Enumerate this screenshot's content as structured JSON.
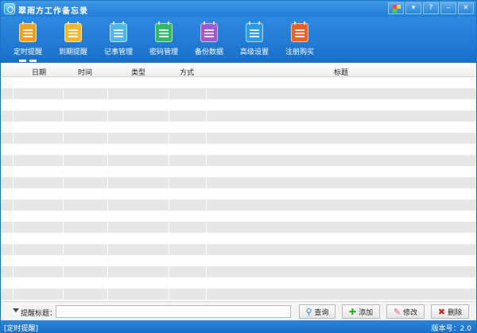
{
  "window": {
    "title": "翠雨方工作备忘录",
    "buttons": [
      "▾",
      "?",
      "–",
      "✕"
    ]
  },
  "toolbar": {
    "items": [
      {
        "label": "定时提醒",
        "icon": "calendar-clock-icon",
        "color": "#f0a020",
        "active": true
      },
      {
        "label": "到期提醒",
        "icon": "calendar-check-icon",
        "color": "#f0b830"
      },
      {
        "label": "记事管理",
        "icon": "notebook-icon",
        "color": "#4fb6ee"
      },
      {
        "label": "密码管理",
        "icon": "password-lock-icon",
        "color": "#36b86a"
      },
      {
        "label": "备份数据",
        "icon": "backup-icon",
        "color": "#a05ad0"
      },
      {
        "label": "高级设置",
        "icon": "settings-gear-icon",
        "color": "#2f9be0"
      },
      {
        "label": "注册购买",
        "icon": "register-icon",
        "color": "#e8622a"
      }
    ]
  },
  "table": {
    "columns": [
      "日期",
      "时间",
      "类型",
      "方式",
      "标题"
    ],
    "rows": []
  },
  "search": {
    "label": "提醒标题：",
    "value": ""
  },
  "actions": {
    "query": "查询",
    "add": "添加",
    "edit": "修改",
    "delete": "删除"
  },
  "status": {
    "left": "[定时提醒]",
    "right": "版本号：2.0"
  }
}
